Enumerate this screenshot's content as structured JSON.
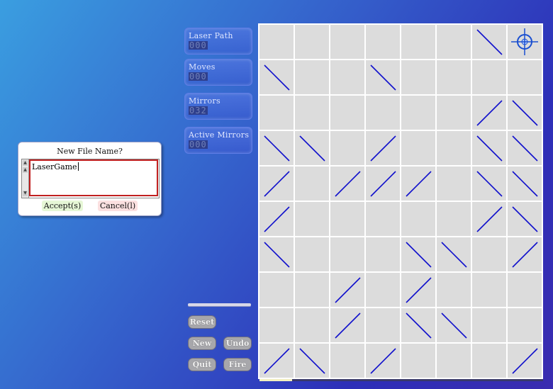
{
  "stats": {
    "laser_path": {
      "label": "Laser Path",
      "value": "000"
    },
    "moves": {
      "label": "Moves",
      "value": "000"
    },
    "mirrors": {
      "label": "Mirrors",
      "value": "032"
    },
    "active_mirrors": {
      "label": "Active Mirrors",
      "value": "000"
    }
  },
  "buttons": {
    "reset": "Reset",
    "new": "New",
    "undo": "Undo",
    "quit": "Quit",
    "fire": "Fire"
  },
  "dialog": {
    "title": "New File Name?",
    "value": "LaserGame",
    "accept": "Accept(s)",
    "cancel": "Cancel(l)"
  },
  "board": {
    "rows": 10,
    "cols": 8,
    "cells": [
      [
        "",
        "",
        "",
        "",
        "",
        "",
        "\\",
        "target"
      ],
      [
        "\\",
        "",
        "",
        "\\",
        "",
        "",
        "",
        ""
      ],
      [
        "",
        "",
        "",
        "",
        "",
        "",
        "/",
        "\\"
      ],
      [
        "\\",
        "\\",
        "",
        "/",
        "",
        "",
        "\\",
        "\\"
      ],
      [
        "/",
        "",
        "/",
        "/",
        "/",
        "",
        "\\",
        "\\"
      ],
      [
        "/",
        "",
        "",
        "",
        "",
        "",
        "/",
        "\\"
      ],
      [
        "\\",
        "",
        "",
        "",
        "\\",
        "\\",
        "",
        "/"
      ],
      [
        "",
        "",
        "/",
        "",
        "/",
        "",
        "",
        ""
      ],
      [
        "",
        "",
        "/",
        "",
        "\\",
        "\\",
        "",
        ""
      ],
      [
        "/",
        "\\",
        "",
        "/",
        "",
        "",
        "",
        "/"
      ]
    ],
    "colors": {
      "mirror": "#1010cc",
      "target": "#1a4fd0",
      "cell": "#dcdcdc"
    }
  }
}
